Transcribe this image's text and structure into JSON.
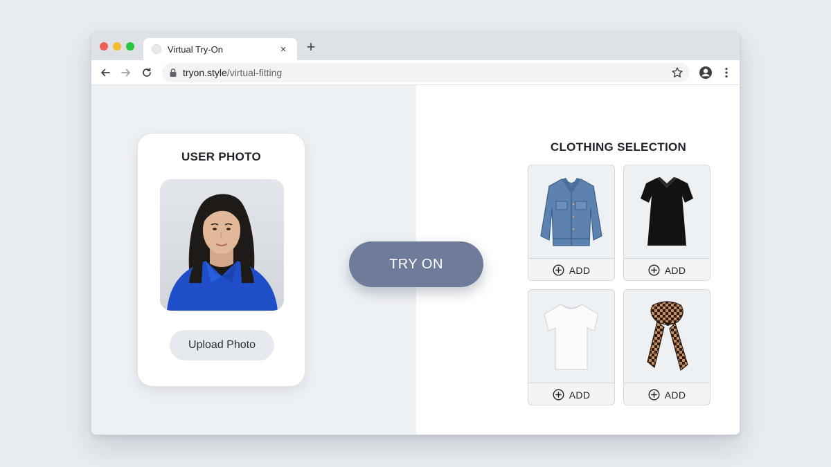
{
  "browser": {
    "tab_title": "Virtual Try-On",
    "tab_close": "×",
    "new_tab": "+",
    "url_host": "tryon.style",
    "url_path": "/virtual-fitting"
  },
  "user_photo": {
    "title": "USER PHOTO",
    "upload_label": "Upload Photo"
  },
  "try_on": {
    "label": "TRY ON"
  },
  "clothing": {
    "title": "CLOTHING SELECTION",
    "items": [
      {
        "icon": "denim-jacket-icon",
        "add_label": "ADD"
      },
      {
        "icon": "black-dress-icon",
        "add_label": "ADD"
      },
      {
        "icon": "white-tshirt-icon",
        "add_label": "ADD"
      },
      {
        "icon": "patterned-scarf-icon",
        "add_label": "ADD"
      }
    ]
  },
  "colors": {
    "try_on_button": "#6f7b9b",
    "left_pane": "#eef1f4",
    "shirt_blue": "#1f4fc8"
  }
}
